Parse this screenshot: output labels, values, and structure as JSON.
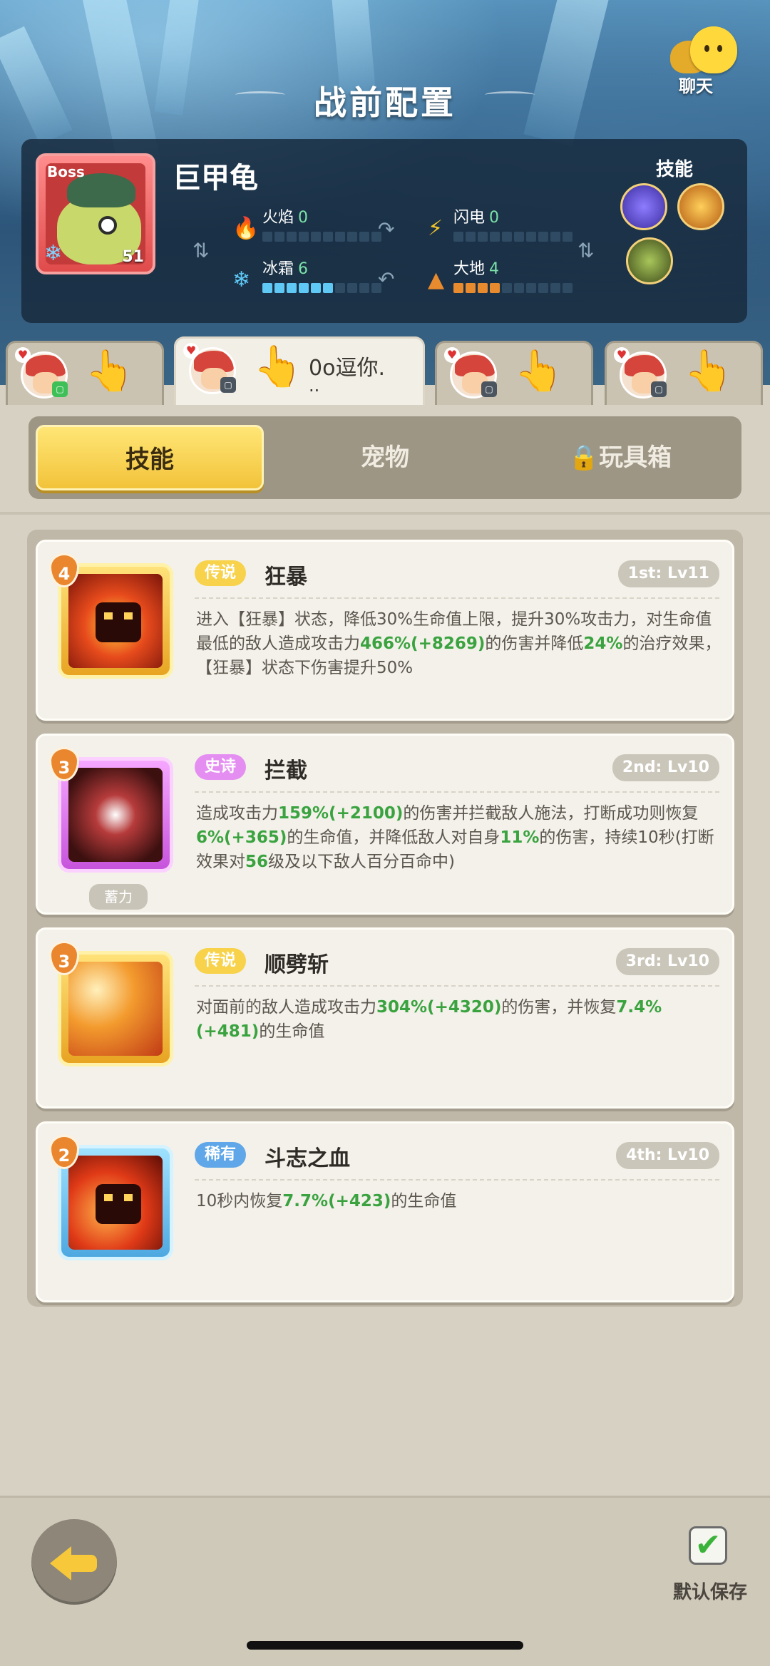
{
  "header": {
    "title": "战前配置",
    "chat_label": "聊天"
  },
  "boss": {
    "tag": "Boss",
    "level": "51",
    "name": "巨甲龟",
    "skills_label": "技能",
    "stats": [
      {
        "label": "火焰",
        "value": "0",
        "level": 0,
        "color": "#e24b2b"
      },
      {
        "label": "闪电",
        "value": "0",
        "level": 0,
        "color": "#f3c52a"
      },
      {
        "label": "冰霜",
        "value": "6",
        "level": 6,
        "color": "#5fc8f5"
      },
      {
        "label": "大地",
        "value": "4",
        "level": 4,
        "color": "#e88a2e"
      }
    ]
  },
  "players": [
    {
      "name": "",
      "active": false
    },
    {
      "name": "0o逗你.",
      "name2": "..",
      "active": true
    },
    {
      "name": "",
      "active": false
    },
    {
      "name": "",
      "active": false
    }
  ],
  "tabs": {
    "skills": "技能",
    "pets": "宠物",
    "toybox": "玩具箱"
  },
  "skills": [
    {
      "rank": "4",
      "rarity": "传说",
      "rarity_type": "legend",
      "name": "狂暴",
      "slot": "1st: Lv11",
      "desc_parts": [
        "进入【狂暴】状态，降低30%生命值上限，提升30%攻击力，对生命值最低的敌人造成攻击力",
        "466%(+8269)",
        "的伤害并降低",
        "24%",
        "的治疗效果，【狂暴】状态下伤害提升50%"
      ]
    },
    {
      "rank": "3",
      "rarity": "史诗",
      "rarity_type": "epic",
      "name": "拦截",
      "slot": "2nd: Lv10",
      "charge": "蓄力",
      "desc_parts": [
        "造成攻击力",
        "159%(+2100)",
        "的伤害并拦截敌人施法，打断成功则恢复",
        "6%(+365)",
        "的生命值，并降低敌人对自身",
        "11%",
        "的伤害，持续10秒(打断效果对",
        "56",
        "级及以下敌人百分百命中)"
      ]
    },
    {
      "rank": "3",
      "rarity": "传说",
      "rarity_type": "legend",
      "name": "顺劈斩",
      "slot": "3rd: Lv10",
      "desc_parts": [
        "对面前的敌人造成攻击力",
        "304%(+4320)",
        "的伤害，并恢复",
        "7.4%(+481)",
        "的生命值"
      ]
    },
    {
      "rank": "2",
      "rarity": "稀有",
      "rarity_type": "rare",
      "name": "斗志之血",
      "slot": "4th: Lv10",
      "desc_parts": [
        "10秒内恢复",
        "7.7%(+423)",
        "的生命值"
      ]
    }
  ],
  "footer": {
    "save_label": "默认保存"
  }
}
